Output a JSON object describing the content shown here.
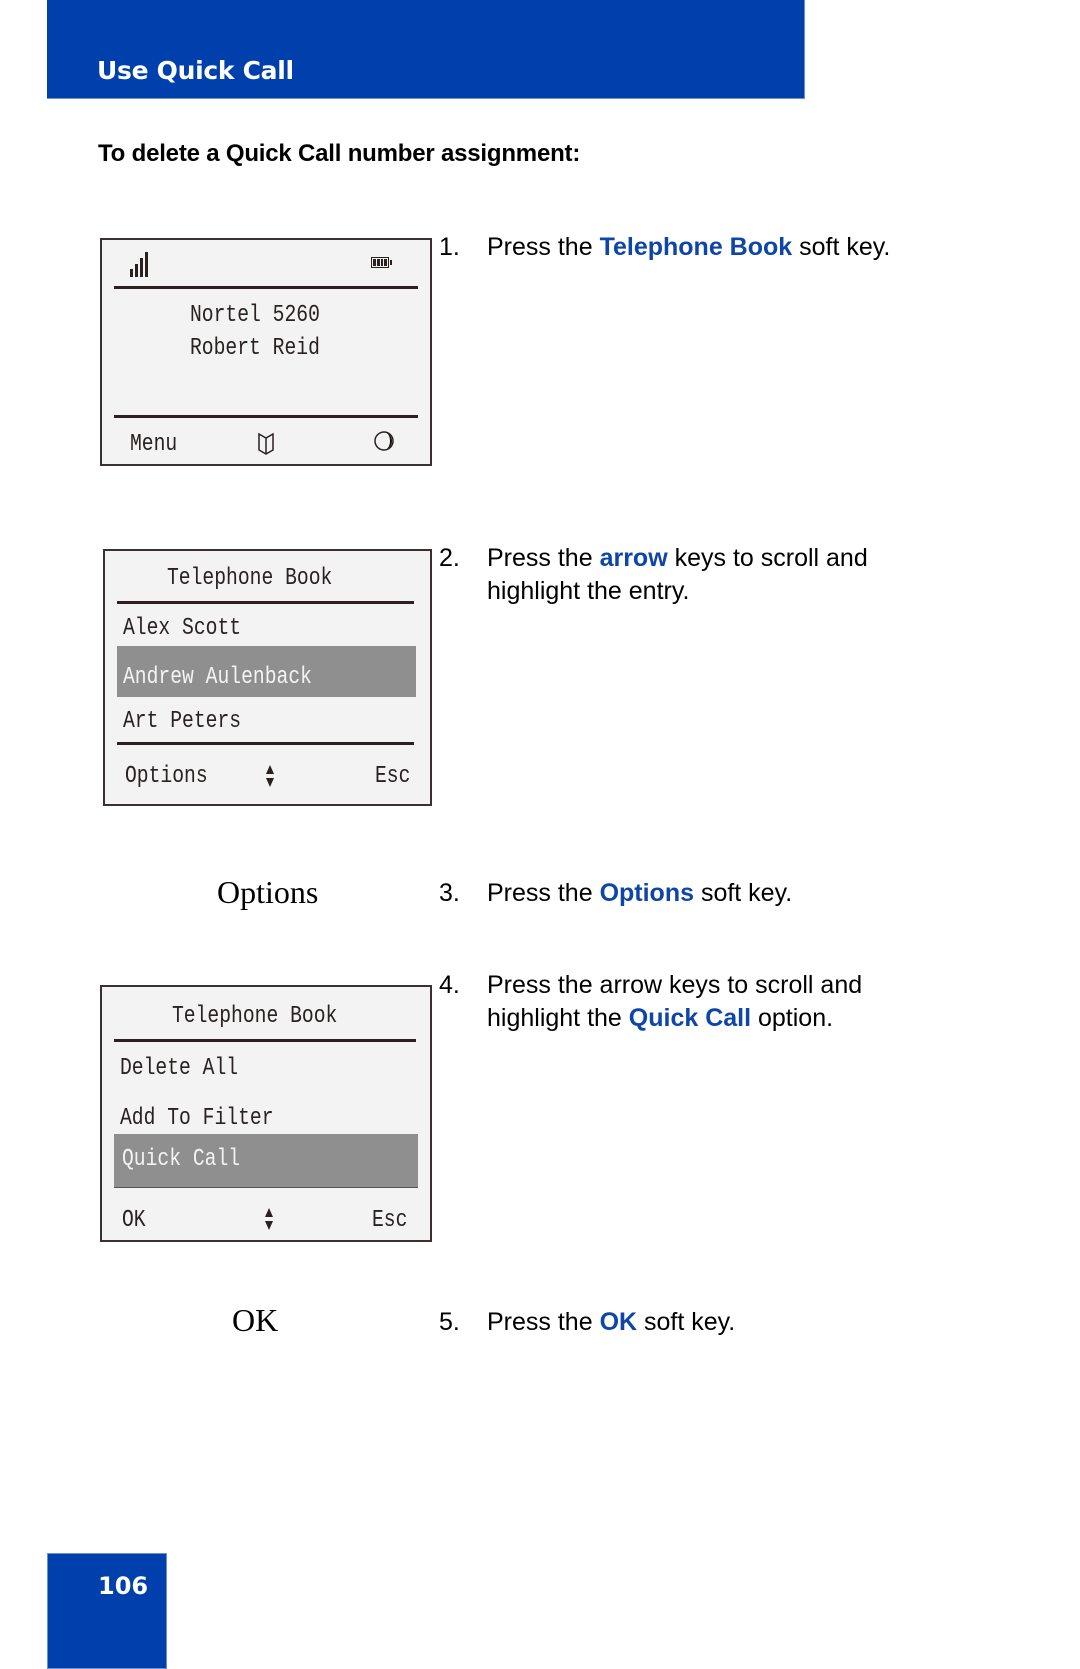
{
  "header": {
    "title": "Use Quick Call"
  },
  "subheading": "To delete a Quick Call number assignment:",
  "colors": {
    "brand_blue": "#0040ac",
    "accent_text": "#0e45a8",
    "highlight_row": "#8f8f8f",
    "screen_bg": "#f2f3f2"
  },
  "screens": {
    "idle": {
      "status_icons": [
        "signal-strength-icon",
        "battery-icon"
      ],
      "line1": "Nortel 5260",
      "line2": "Robert Reid",
      "softkeys": {
        "left": "Menu",
        "center_icon": "telephone-book-icon",
        "right_icon": "presence-icon"
      }
    },
    "phonebook": {
      "title": "Telephone Book",
      "items": [
        "Alex Scott",
        "Andrew Aulenback",
        "Art Peters"
      ],
      "selected_index": 1,
      "softkeys": {
        "left": "Options",
        "center_icon": "up-down-arrow-icon",
        "right": "Esc"
      }
    },
    "options_menu": {
      "title": "Telephone Book",
      "items": [
        "Delete All",
        "Add To Filter",
        "Quick Call"
      ],
      "selected_index": 2,
      "softkeys": {
        "left": "OK",
        "center_icon": "up-down-arrow-icon",
        "right": "Esc"
      }
    }
  },
  "key_labels": {
    "options": "Options",
    "ok": "OK"
  },
  "steps": [
    {
      "num": "1.",
      "pre": "Press the ",
      "accent": "Telephone Book",
      "post": " soft key."
    },
    {
      "num": "2.",
      "pre": "Press the ",
      "accent": "arrow",
      "post": " keys to scroll and",
      "line2": "highlight the entry."
    },
    {
      "num": "3.",
      "pre": "Press the ",
      "accent": "Options",
      "post": " soft key."
    },
    {
      "num": "4.",
      "line1": "Press the arrow keys to scroll and",
      "line2_pre": "highlight the ",
      "line2_accent": "Quick Call",
      "line2_post": " option."
    },
    {
      "num": "5.",
      "pre": "Press the ",
      "accent": "OK",
      "post": " soft key."
    }
  ],
  "page_number": "106"
}
